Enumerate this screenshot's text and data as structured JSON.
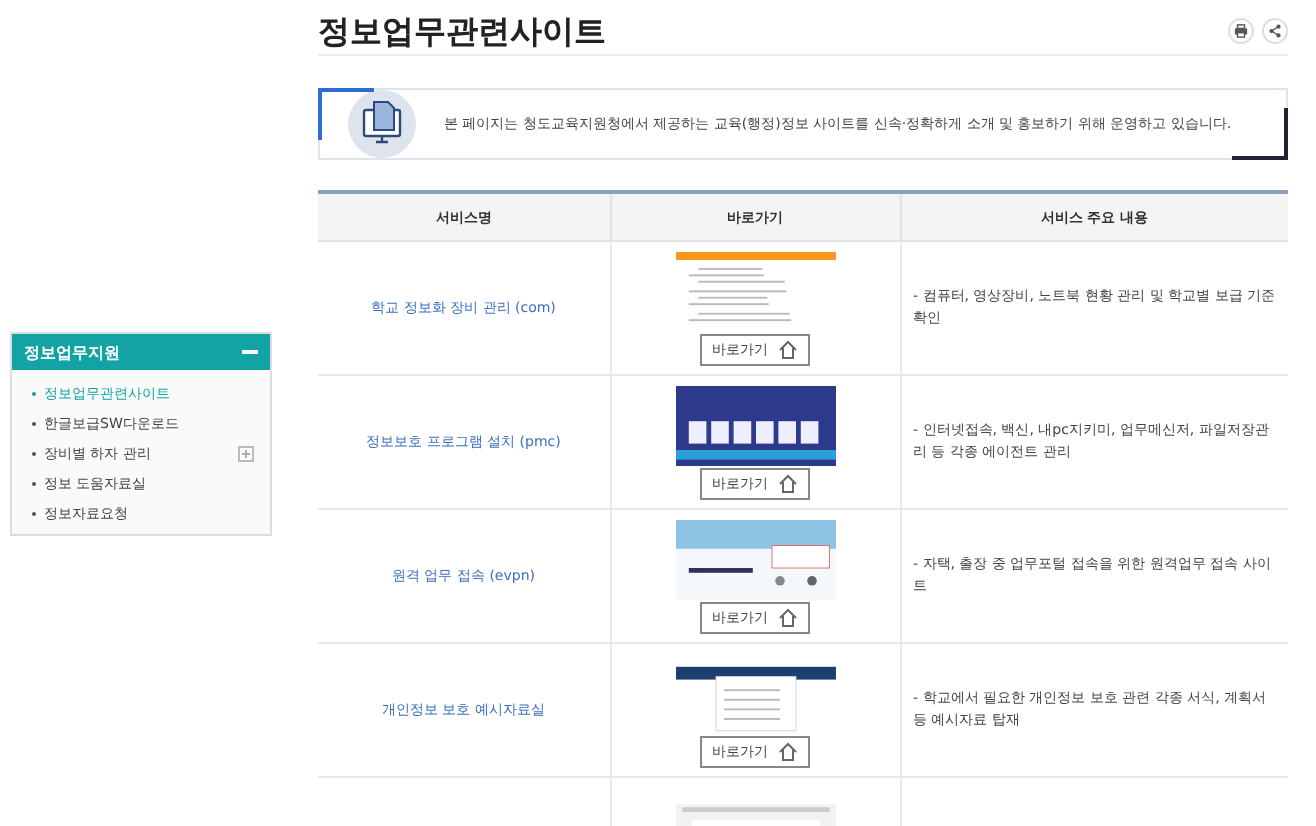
{
  "sidebar": {
    "title": "정보업무지원",
    "expanded": true,
    "items": [
      {
        "label": "정보업무관련사이트",
        "selected": true,
        "kind": "link"
      },
      {
        "label": "한글보급SW다운로드",
        "selected": false,
        "kind": "link"
      },
      {
        "label": "장비별 하자 관리",
        "selected": false,
        "kind": "folder"
      },
      {
        "label": "정보 도움자료실",
        "selected": false,
        "kind": "link"
      },
      {
        "label": "정보자료요청",
        "selected": false,
        "kind": "link"
      }
    ]
  },
  "page": {
    "title": "정보업무관련사이트",
    "intro": "본 페이지는 청도교육지원청에서 제공하는 교육(행정)정보 사이트를 신속·정확하게 소개 및 홍보하기 위해 운영하고 있습니다."
  },
  "table": {
    "columns": [
      "서비스명",
      "바로가기",
      "서비스 주요 내용"
    ],
    "rows": [
      {
        "name": "학교 정보화 장비 관리 (com)",
        "kind": "orange",
        "button": "바로가기",
        "description": "- 컴퓨터, 영상장비, 노트북 현황 관리 및 학교별 보급 기준 확인"
      },
      {
        "name": "정보보호 프로그램 설치 (pmc)",
        "kind": "blue",
        "button": "바로가기",
        "description": "- 인터넷접속, 백신, 내pc지키미, 업무메신저, 파일저장관리 등 각종 에이전트 관리"
      },
      {
        "name": "원격 업무 접속 (evpn)",
        "kind": "sky",
        "button": "바로가기",
        "description": "- 자택, 출장 중 업무포털 접속을 위한 원격업무 접속 사이트"
      },
      {
        "name": "개인정보 보호 예시자료실",
        "kind": "navy",
        "button": "바로가기",
        "description": "- 학교에서 필요한 개인정보 보호 관련 각종 서식, 계획서 등 예시자료 탑재"
      },
      {
        "kind": "grey"
      }
    ]
  }
}
